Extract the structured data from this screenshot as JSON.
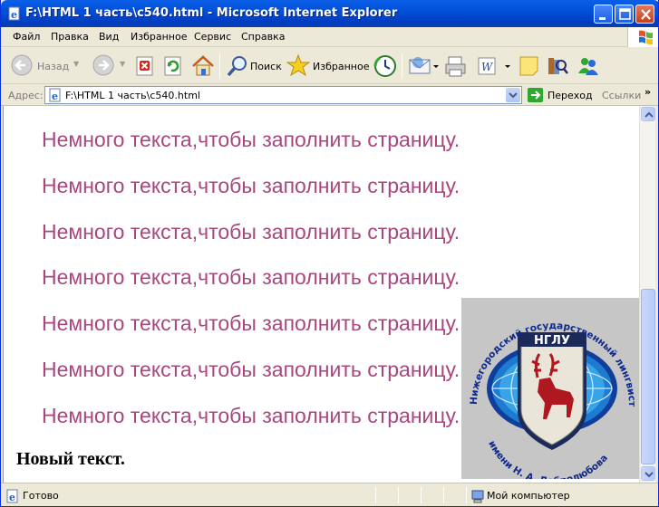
{
  "window": {
    "title": "F:\\HTML 1 часть\\c540.html - Microsoft Internet Explorer",
    "icon": "ie-page-icon",
    "controls": [
      "minimize-icon",
      "maximize-icon",
      "close-icon"
    ]
  },
  "menu": {
    "items": [
      "Файл",
      "Правка",
      "Вид",
      "Избранное",
      "Сервис",
      "Справка"
    ]
  },
  "toolbar": {
    "back_label": "Назад",
    "search_label": "Поиск",
    "favorites_label": "Избранное",
    "icons": [
      "back-icon",
      "forward-icon",
      "stop-icon",
      "refresh-icon",
      "home-icon",
      "search-icon",
      "favorites-star-icon",
      "history-icon",
      "mail-icon",
      "print-icon",
      "edit-word-icon",
      "discuss-icon",
      "research-icon",
      "messenger-icon"
    ]
  },
  "address": {
    "label": "Адрес:",
    "value": "F:\\HTML 1 часть\\c540.html",
    "go_label": "Переход",
    "links_label": "Ссылки",
    "links_chevron": "»"
  },
  "content": {
    "filler_lines": [
      "Немного текста,чтобы заполнить страницу.",
      "Немного текста,чтобы заполнить страницу.",
      "Немного текста,чтобы заполнить страницу.",
      "Немного текста,чтобы заполнить страницу.",
      "Немного текста,чтобы заполнить страницу.",
      "Немного текста,чтобы заполнить страницу.",
      "Немного текста,чтобы заполнить страницу."
    ],
    "new_text": "Новый текст.",
    "filler_color": "#a8477e",
    "logo": {
      "abbr": "НГЛУ",
      "arc_top": "Нижегородский государственный лингвистический университет",
      "arc_bottom": "имени Н. А. Добролюбова"
    }
  },
  "status": {
    "text": "Готово",
    "zone": "Мой компьютер"
  }
}
